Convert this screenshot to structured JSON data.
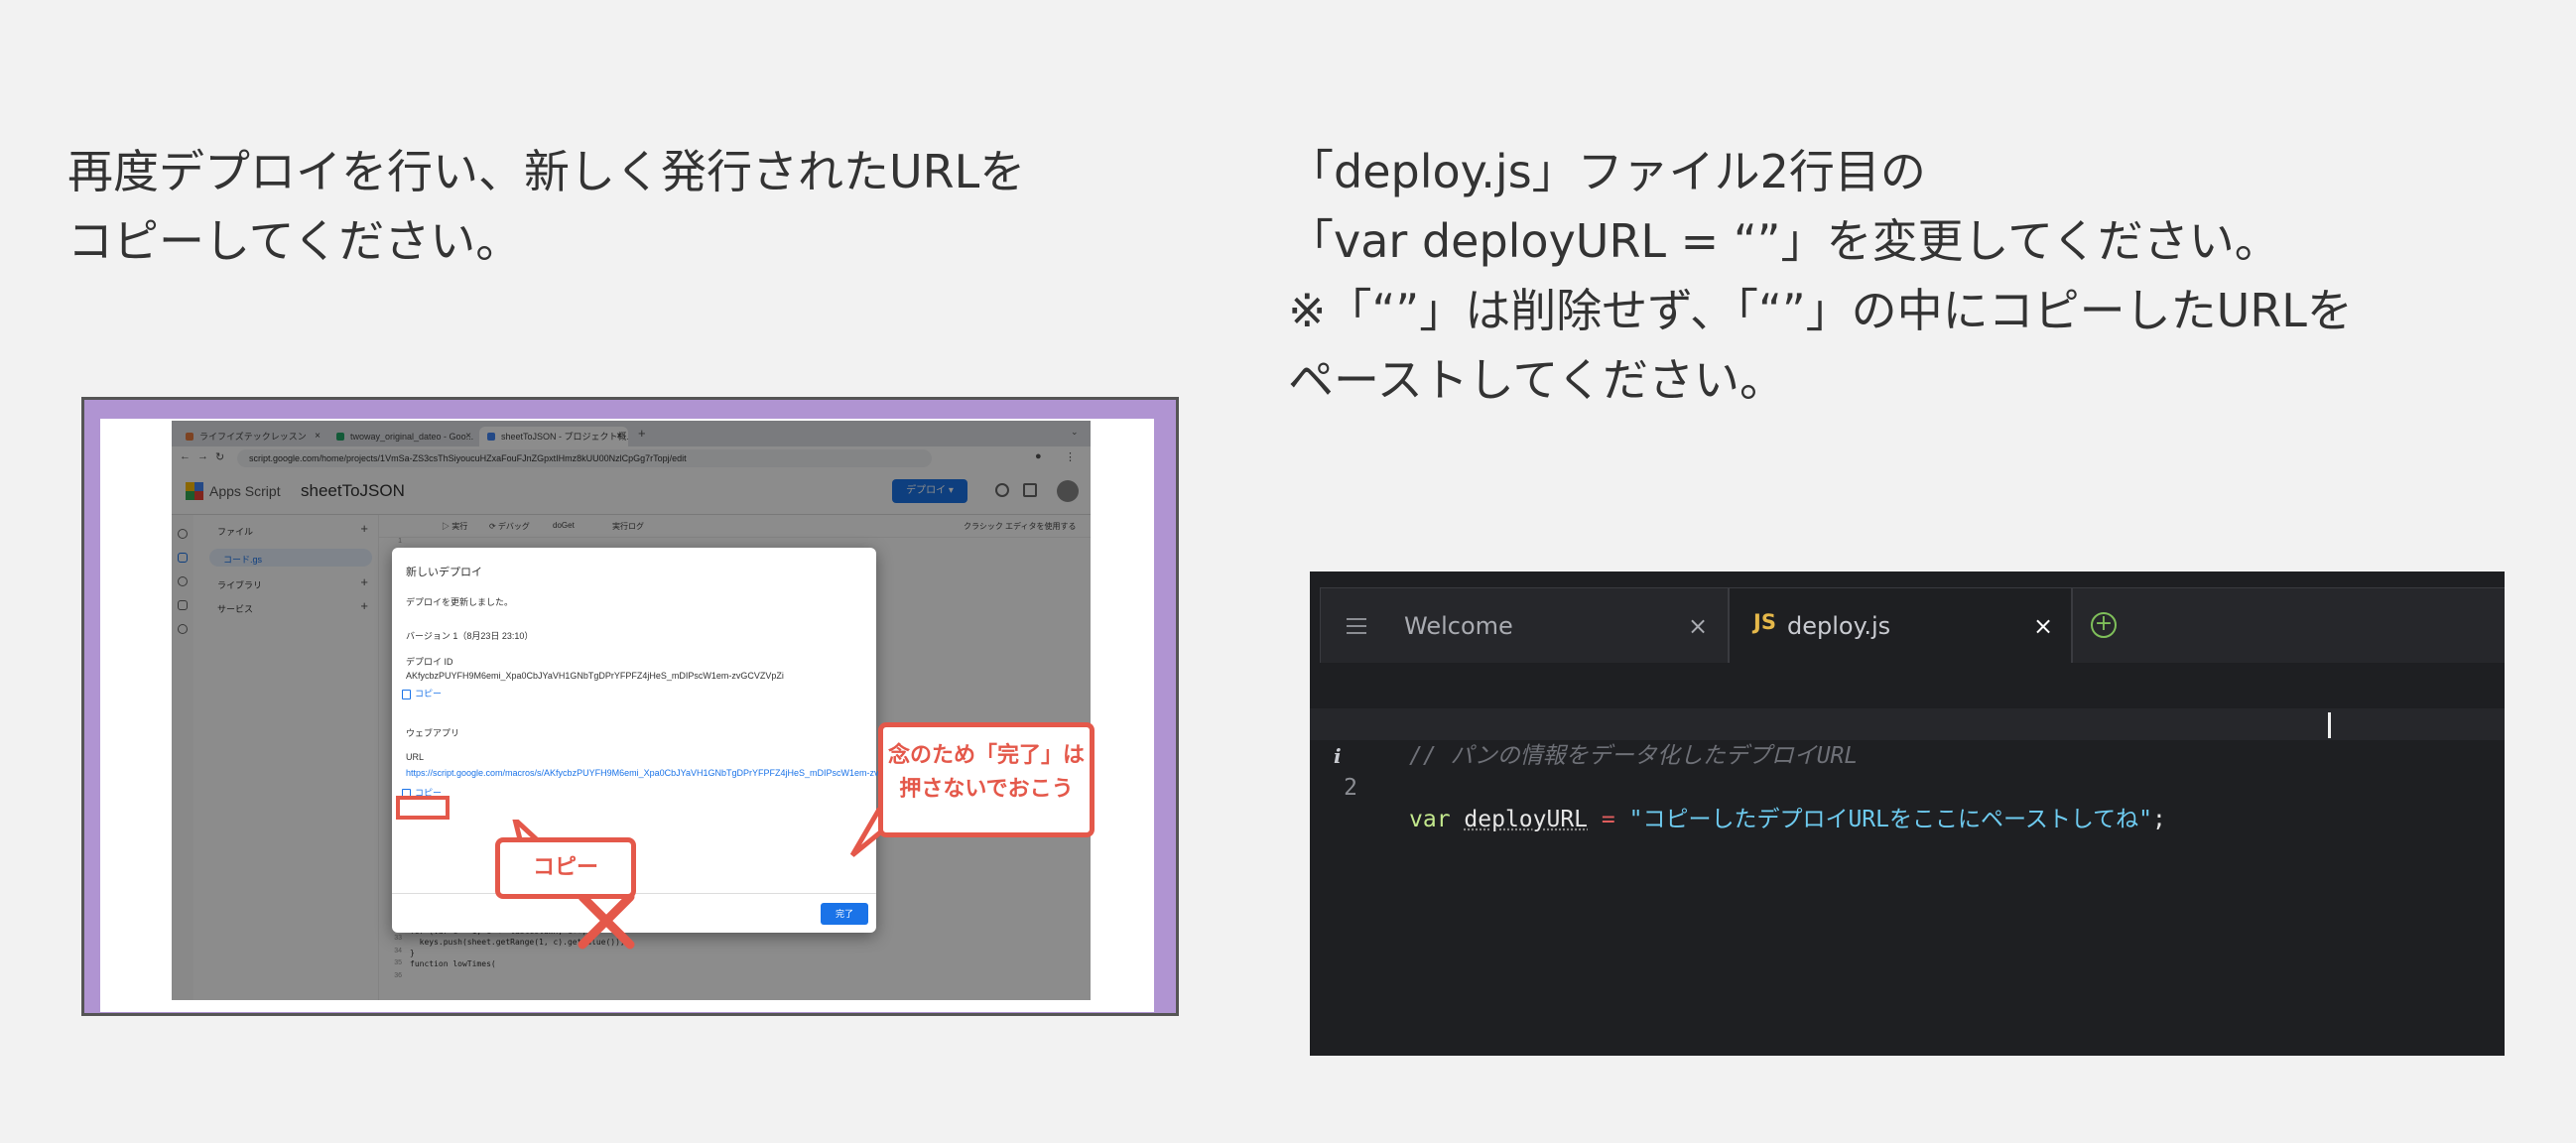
{
  "instructions": {
    "left": "再度デプロイを行い、新しく発行されたURLを\nコピーしてください。",
    "right": "「deploy.js」ファイル2行目の\n「var deployURL = “”」を変更してください。\n※「“”」は削除せず、「“”」の中にコピーしたURLを\nペーストしてください。"
  },
  "screenshot": {
    "browser_tabs": [
      {
        "label": "ライフイズテックレッスン"
      },
      {
        "label": "twoway_original_dateo - Goo..."
      },
      {
        "label": "sheetToJSON - プロジェクト概..."
      }
    ],
    "url": "script.google.com/home/projects/1VmSa-ZS3csThSiyoucuHZxaFouFJnZGpxtIHmz8kUU00NzlCpGg7rTopj/edit",
    "app_name": "Apps Script",
    "project_name": "sheetToJSON",
    "deploy_button": "デプロイ ▾",
    "sidebar": {
      "files": "ファイル",
      "file_item": "コード.gs",
      "libraries": "ライブラリ",
      "services": "サービス"
    },
    "toolbar": {
      "run": "▷ 実行",
      "debug": "⟳ デバッグ",
      "function": "doGet",
      "log": "実行ログ",
      "classic": "クラシック エディタを使用する"
    },
    "dialog": {
      "title": "新しいデプロイ",
      "updated": "デプロイを更新しました。",
      "version": "バージョン 1（8月23日 23:10）",
      "deploy_id_label": "デプロイ ID",
      "deploy_id": "AKfycbzPUYFH9M6emi_Xpa0CbJYaVH1GNbTgDPrYFPFZ4jHeS_mDIPscW1em-zvGCVZVpZi",
      "copy_1": "コピー",
      "webapp_label": "ウェブアプリ",
      "url_label": "URL",
      "webapp_url": "https://script.google.com/macros/s/AKfycbzPUYFH9M6emi_Xpa0CbJYaVH1GNbTgDPrYFPFZ4jHeS_mDIPscW1em-zvG...",
      "copy_2": "コピー",
      "done": "完了"
    },
    "code_tail": "// 最後の行\nfor (var c = 1; c <= lastColumn; c++) {\n  keys.push(sheet.getRange(1, c).getValue());\n}\nfunction lowTimes(",
    "callout_copy": "コピー",
    "callout_warn": "念のため「完了」は\n押さないでおこう",
    "callout_color": "#e4584a"
  },
  "editor": {
    "tabs": [
      {
        "label": "Welcome",
        "close": "×"
      },
      {
        "label": "deploy.js",
        "badge": "JS",
        "close": "×",
        "active": true
      }
    ],
    "lines": [
      {
        "num": "1",
        "comment": "// パンの情報をデータ化したデプロイURL"
      },
      {
        "num": "2",
        "info": "i",
        "keyword": "var",
        "identifier": "deployURL",
        "operator": "=",
        "string": "\"コピーしたデプロイURLをここにペーストしてね\"",
        "end": ";"
      }
    ],
    "colors": {
      "background": "#1e1f22",
      "keyword": "#c3e88d",
      "string": "#6ecbf0",
      "operator": "#e05d5d",
      "js_badge": "#e5b84a",
      "add_icon": "#7fbf5a"
    },
    "icons": [
      "menu-icon",
      "js-file-icon",
      "close-icon",
      "add-tab-icon",
      "info-icon"
    ]
  }
}
